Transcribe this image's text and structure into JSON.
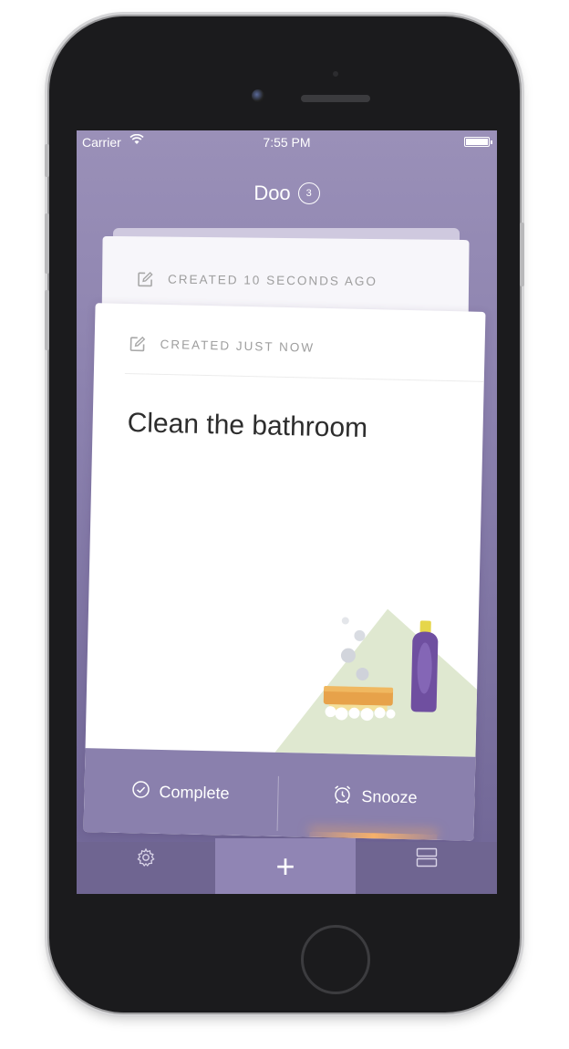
{
  "status_bar": {
    "carrier": "Carrier",
    "wifi_icon": "wifi-icon",
    "time": "7:55 PM",
    "battery_icon": "battery-icon"
  },
  "header": {
    "title": "Doo",
    "count": "3"
  },
  "back_card": {
    "meta": "CREATED 10 SECONDS AGO",
    "icon": "edit-icon"
  },
  "front_card": {
    "meta": "CREATED JUST NOW",
    "icon": "edit-icon",
    "title": "Clean the bathroom",
    "illustration": "cleaning-supplies-illustration"
  },
  "card_actions": {
    "complete_label": "Complete",
    "complete_icon": "check-circle-icon",
    "snooze_label": "Snooze",
    "snooze_icon": "alarm-clock-icon"
  },
  "toolbar": {
    "settings_icon": "gear-icon",
    "add_label": "+",
    "list_icon": "list-icon"
  },
  "colors": {
    "accent": "#8a80ad",
    "background_top": "#9a90b8",
    "background_bottom": "#6f6595"
  }
}
